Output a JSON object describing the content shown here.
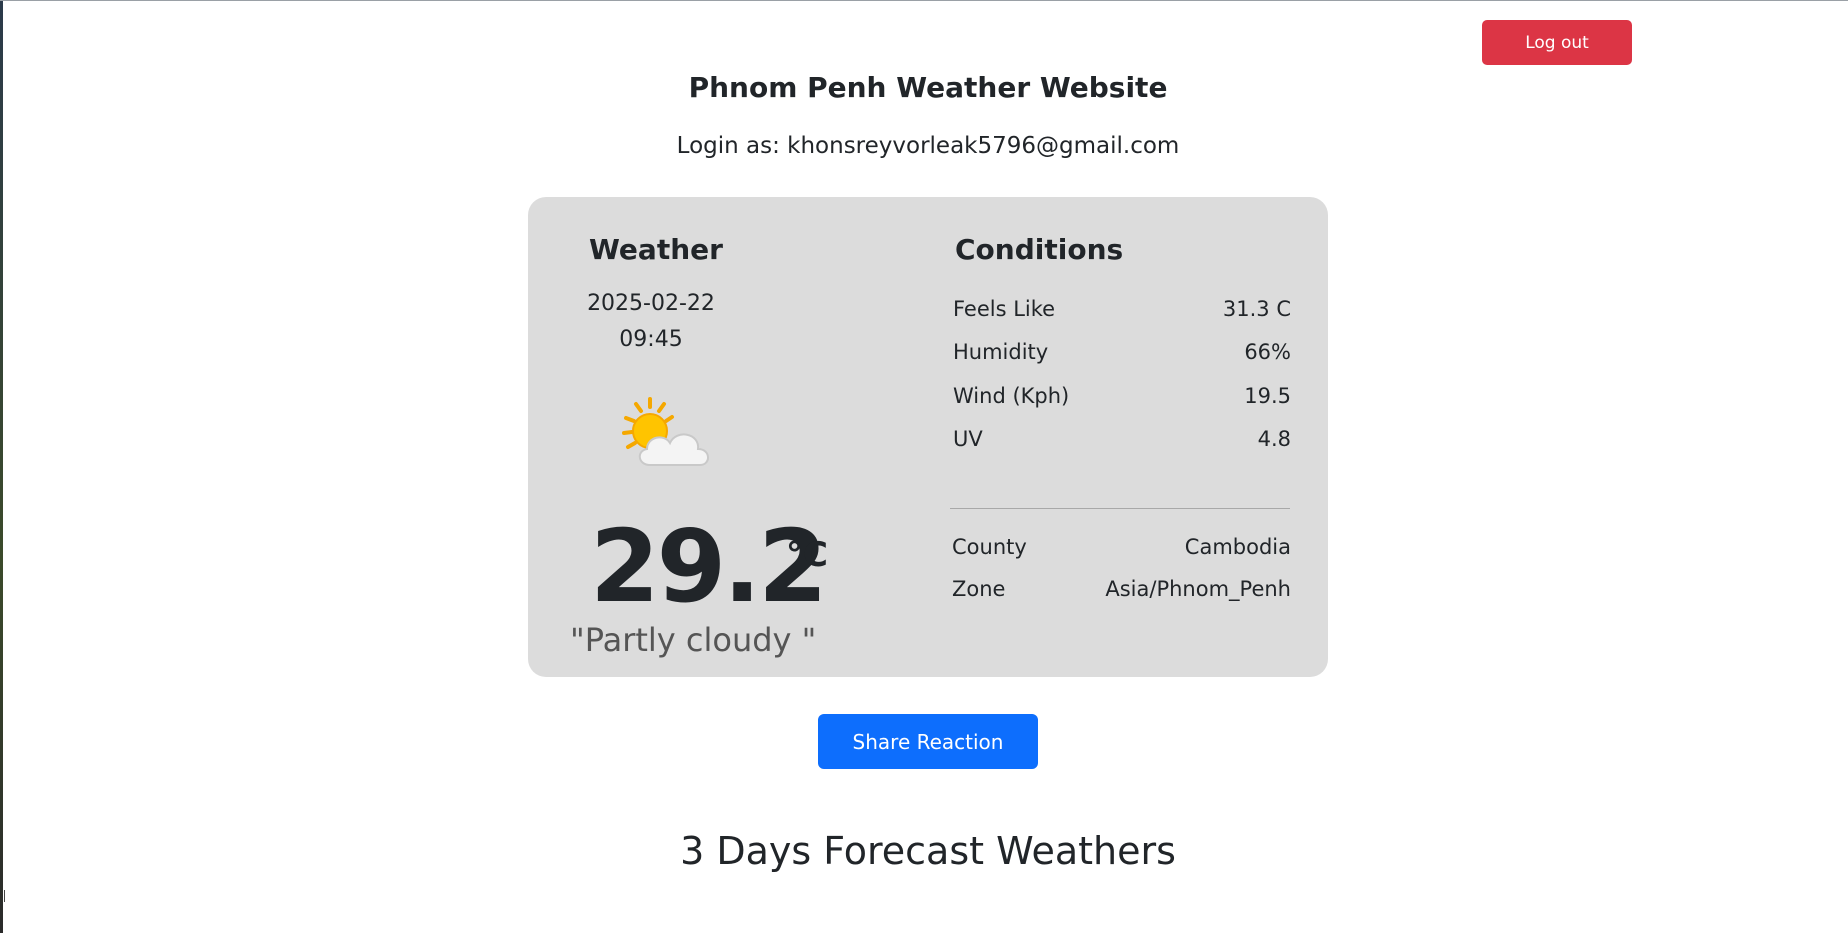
{
  "header": {
    "logout_label": "Log out",
    "site_title": "Phnom Penh Weather Website",
    "login_line": "Login as: khonsreyvorleak5796@gmail.com"
  },
  "weather": {
    "heading": "Weather",
    "date": "2025-02-22",
    "time": "09:45",
    "icon": "partly-cloudy-icon",
    "temperature": "29.2",
    "unit": "°C",
    "condition": "\"Partly cloudy \""
  },
  "conditions": {
    "heading": "Conditions",
    "rows": [
      {
        "label": "Feels Like",
        "value": "31.3 C"
      },
      {
        "label": "Humidity",
        "value": "66%"
      },
      {
        "label": "Wind (Kph)",
        "value": "19.5"
      },
      {
        "label": "UV",
        "value": "4.8"
      }
    ],
    "location": [
      {
        "label": "County",
        "value": "Cambodia"
      },
      {
        "label": "Zone",
        "value": "Asia/Phnom_Penh"
      }
    ]
  },
  "actions": {
    "share_label": "Share Reaction"
  },
  "forecast": {
    "title": "3 Days Forecast Weathers"
  },
  "colors": {
    "logout_bg": "#dc3545",
    "share_bg": "#0d6efd",
    "card_bg": "#dcdcdc"
  }
}
